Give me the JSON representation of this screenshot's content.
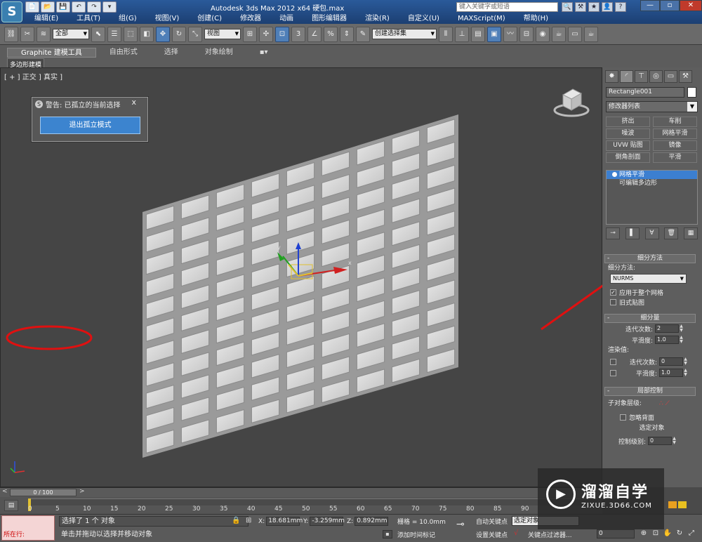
{
  "title_bar": {
    "app_logo": "S",
    "window_title": "Autodesk 3ds Max  2012 x64      硬包.max",
    "search_placeholder": "键入关键字或短语",
    "quick_access": [
      "📄",
      "📂",
      "💾",
      "↶",
      "↷",
      "▾"
    ],
    "help_icons": [
      "🔍",
      "⚒",
      "★",
      "👤",
      "?"
    ],
    "window_controls": [
      "—",
      "▫",
      "✕"
    ]
  },
  "menu": {
    "items": [
      "编辑(E)",
      "工具(T)",
      "组(G)",
      "视图(V)",
      "创建(C)",
      "修改器",
      "动画",
      "图形编辑器",
      "渲染(R)",
      "自定义(U)",
      "MAXScript(M)",
      "帮助(H)"
    ]
  },
  "toolbar": {
    "selection_filter": "全部",
    "ref_coord": "视图",
    "named_selection": "创建选择集"
  },
  "ribbon": {
    "tabs": [
      "Graphite 建模工具",
      "自由形式",
      "选择",
      "对象绘制",
      "▪▾"
    ],
    "sub_label": "多边形建模"
  },
  "viewport": {
    "label": "[ + ] 正交 ] 真实 ]",
    "dialog_title": "警告: 已孤立的当前选择",
    "dialog_close": "x",
    "exit_isolation_button": "退出孤立模式",
    "gizmo_axes": {
      "x": "x",
      "y": "y",
      "z": "z"
    }
  },
  "command_panel": {
    "object_name": "Rectangle001",
    "object_color": "#ffffff",
    "modifier_list": "修改器列表",
    "modifier_buttons": [
      "挤出",
      "车削",
      "噪波",
      "网格平滑",
      "UVW 贴图",
      "镜像",
      "倒角剖面",
      "平滑"
    ],
    "stack": [
      {
        "label": "网格平滑",
        "selected": true
      },
      {
        "label": "可编辑多边形",
        "selected": false
      }
    ],
    "subdivision_method": {
      "header": "细分方法",
      "label": "细分方法:",
      "value": "NURMS",
      "apply_whole_mesh": "应用于整个网格",
      "apply_whole_mesh_checked": true,
      "old_style_mapping": "旧式贴图",
      "old_style_mapping_checked": false
    },
    "subdivision_amount": {
      "header": "细分量",
      "iterations_label": "迭代次数:",
      "iterations_value": "2",
      "smoothness_label": "平滑度:",
      "smoothness_value": "1.0",
      "render_values_label": "渲染值:",
      "render_iterations_label": "迭代次数:",
      "render_iterations_value": "0",
      "render_smoothness_label": "平滑度:",
      "render_smoothness_value": "1.0"
    },
    "local_control": {
      "header": "局部控制",
      "subobject_label": "子对象层级:",
      "ignore_backfacing": "忽略背面",
      "selected_object": "选定对象",
      "control_level_label": "控制级别:",
      "control_level_value": "0"
    }
  },
  "time_slider": {
    "position": "0 / 100",
    "left_arrow": "<",
    "right_arrow": ">"
  },
  "track": {
    "ticks": [
      "0",
      "5",
      "10",
      "15",
      "20",
      "25",
      "30",
      "35",
      "40",
      "45",
      "50",
      "55",
      "60",
      "65",
      "70",
      "75",
      "80",
      "85",
      "90"
    ]
  },
  "status": {
    "running_label": "所在行:",
    "line1": "选择了 1 个 对象",
    "line2": "单击并拖动以选择并移动对象",
    "x_label": "X:",
    "x_value": "18.681mm",
    "y_label": "Y:",
    "y_value": "-3.259mm",
    "z_label": "Z:",
    "z_value": "0.892mm",
    "grid": "栅格 = 10.0mm",
    "add_time_tag": "添加时间标记",
    "auto_key": "自动关键点",
    "set_key": "设置关键点",
    "selection_set": "选定对象",
    "key_filters": "关键点过滤器...",
    "frame": "0"
  },
  "watermark": {
    "name": "溜溜自学",
    "url": "ZIXUE.3D66.COM"
  },
  "colors": {
    "accent_blue": "#3c84cf",
    "annotation_red": "#e01010",
    "tile_surface": "#d8d8d8"
  }
}
